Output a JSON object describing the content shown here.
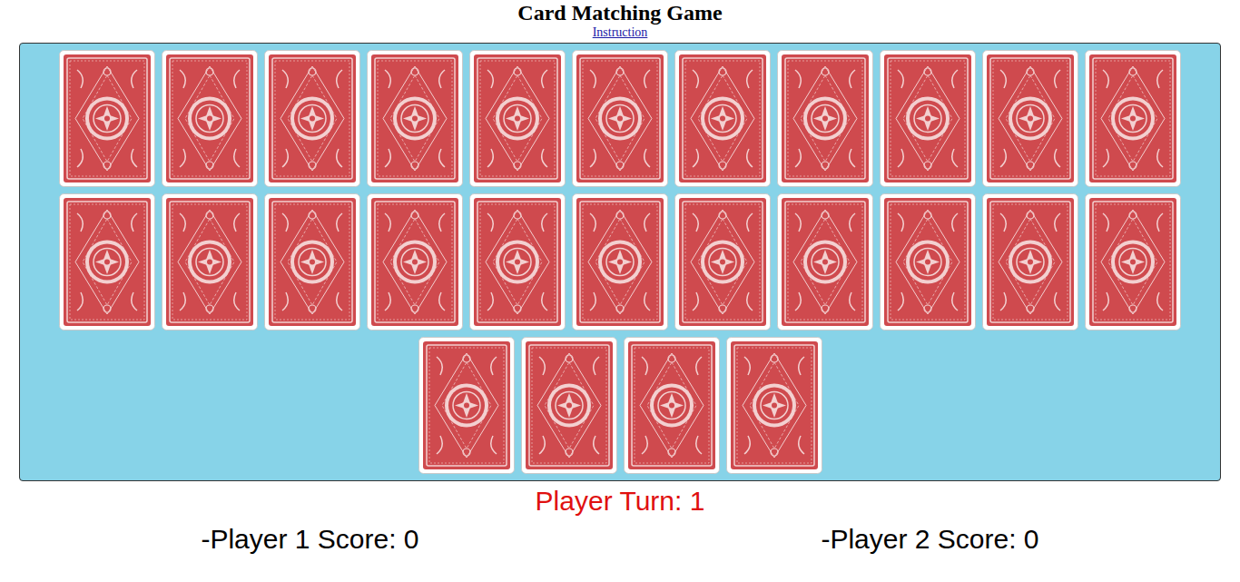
{
  "window": {
    "title": "Card Matching Game"
  },
  "instruction_link": "Instruction",
  "board": {
    "cards": [
      {
        "face_up": false
      },
      {
        "face_up": false
      },
      {
        "face_up": false
      },
      {
        "face_up": false
      },
      {
        "face_up": false
      },
      {
        "face_up": false
      },
      {
        "face_up": false
      },
      {
        "face_up": false
      },
      {
        "face_up": false
      },
      {
        "face_up": false
      },
      {
        "face_up": false
      },
      {
        "face_up": false
      },
      {
        "face_up": false
      },
      {
        "face_up": false
      },
      {
        "face_up": false
      },
      {
        "face_up": false
      },
      {
        "face_up": false
      },
      {
        "face_up": false
      },
      {
        "face_up": false
      },
      {
        "face_up": false
      },
      {
        "face_up": false
      },
      {
        "face_up": false
      },
      {
        "face_up": false
      },
      {
        "face_up": false
      },
      {
        "face_up": false
      },
      {
        "face_up": false
      }
    ]
  },
  "player_turn": "Player Turn: 1",
  "scores": [
    "-Player 1 Score: 0",
    "-Player 2 Score: 0"
  ]
}
